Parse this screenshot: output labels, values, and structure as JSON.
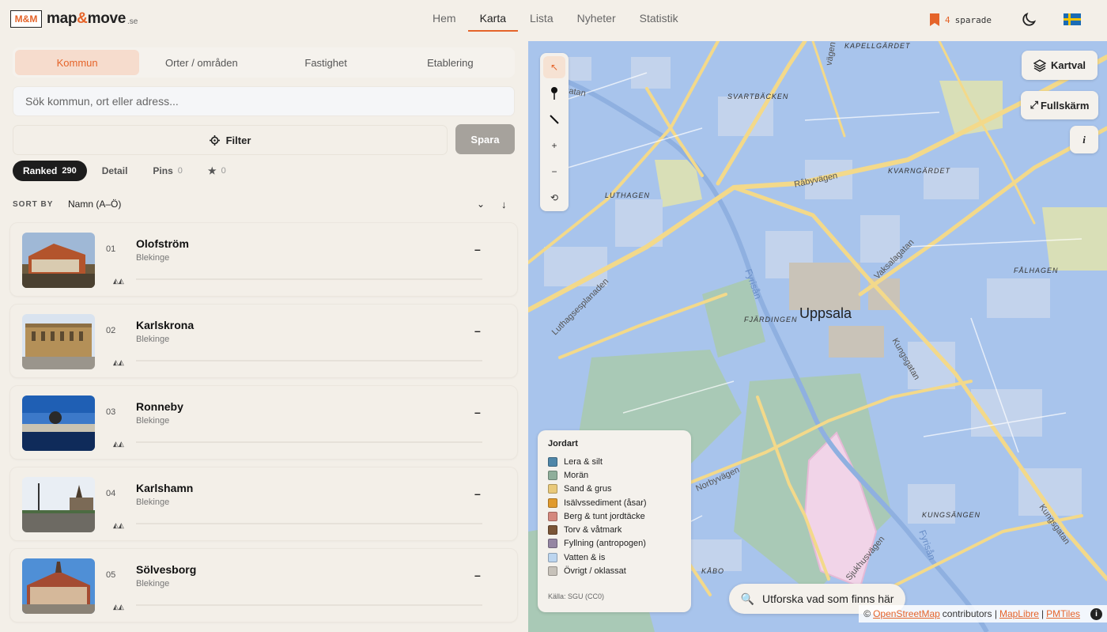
{
  "header": {
    "logo_mark": "M&M",
    "logo_text_a": "map",
    "logo_text_amp": "&",
    "logo_text_b": "move",
    "logo_suffix": ".se",
    "nav": [
      "Hem",
      "Karta",
      "Lista",
      "Nyheter",
      "Statistik"
    ],
    "nav_active": "Karta",
    "saved_count": "4",
    "saved_label": "sparade"
  },
  "sidebar": {
    "tabs": [
      "Kommun",
      "Orter / områden",
      "Fastighet",
      "Etablering"
    ],
    "search_placeholder": "Sök kommun, ort eller adress...",
    "filter_label": "Filter",
    "save_label": "Spara",
    "subtabs": [
      {
        "label": "Ranked",
        "count": "290"
      },
      {
        "label": "Detail",
        "count": ""
      },
      {
        "label": "Pins",
        "count": "0"
      },
      {
        "label": "★",
        "count": "0"
      }
    ],
    "sort_label": "SORT BY",
    "sort_value": "Namn (A–Ö)",
    "items": [
      {
        "rank": "01",
        "name": "Olofström",
        "region": "Blekinge",
        "value": "–"
      },
      {
        "rank": "02",
        "name": "Karlskrona",
        "region": "Blekinge",
        "value": "–"
      },
      {
        "rank": "03",
        "name": "Ronneby",
        "region": "Blekinge",
        "value": "–"
      },
      {
        "rank": "04",
        "name": "Karlshamn",
        "region": "Blekinge",
        "value": "–"
      },
      {
        "rank": "05",
        "name": "Sölvesborg",
        "region": "Blekinge",
        "value": "–"
      }
    ]
  },
  "map": {
    "layers_label": "Kartval",
    "fullscreen_label": "Fullskärm",
    "info_label": "i",
    "city": "Uppsala",
    "districts": [
      "KAPELLGÄRDET",
      "SVARTBÄCKEN",
      "KVARNGÄRDET",
      "LUTHAGEN",
      "FÅLHAGEN",
      "FJÄRDINGEN",
      "KUNGSÄNGEN",
      "KÅBO"
    ],
    "streets": [
      "Råbyvägen",
      "Vaksalagatan",
      "Kungsgatan",
      "Luthagsesplanaden",
      "Norbyvägen",
      "Sjukhusvägen",
      "Kungsgatan",
      "svallsgatan",
      "vägen"
    ],
    "water": [
      "Fyrisån",
      "Fyrisån"
    ],
    "legend": {
      "title": "Jordart",
      "items": [
        {
          "label": "Lera & silt",
          "color": "#4f86a8"
        },
        {
          "label": "Morän",
          "color": "#8fae9a"
        },
        {
          "label": "Sand & grus",
          "color": "#e9c97a"
        },
        {
          "label": "Isälvssediment (åsar)",
          "color": "#e09a2e"
        },
        {
          "label": "Berg & tunt jordtäcke",
          "color": "#d4887e"
        },
        {
          "label": "Torv & våtmark",
          "color": "#7a5537"
        },
        {
          "label": "Fyllning (antropogen)",
          "color": "#9586a3"
        },
        {
          "label": "Vatten & is",
          "color": "#bcd5ef"
        },
        {
          "label": "Övrigt / oklassat",
          "color": "#c7c2ba"
        }
      ],
      "source": "Källa: SGU (CC0)"
    },
    "explore_label": "Utforska vad som finns här",
    "attribution": {
      "prefix": "©",
      "osm": "OpenStreetMap",
      "mid": "contributors |",
      "maplibre": "MapLibre",
      "sep": "|",
      "pmtiles": "PMTiles"
    }
  },
  "colors": {
    "accent": "#e5642a",
    "map_base": "#a8c4ec",
    "road": "#f3d98a"
  }
}
